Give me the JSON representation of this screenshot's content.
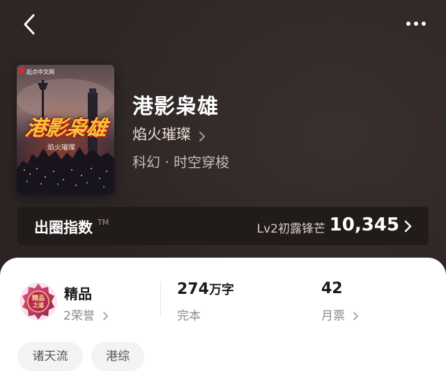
{
  "book": {
    "title": "港影枭雄",
    "author": "焰火璀璨",
    "tags_line": "科幻 · 时空穿梭"
  },
  "cover": {
    "publisher": "起点中文网",
    "title_art": "港影枭雄",
    "author_art": "焰火璀璨"
  },
  "index_bar": {
    "label": "出圈指数",
    "tm": "TM",
    "level": "Lv2初露锋芒",
    "value": "10,345"
  },
  "stats": {
    "honor_title": "精品",
    "honor_sub": "2荣誉",
    "words_number": "274",
    "words_unit": "万字",
    "words_sub": "完本",
    "tickets_number": "42",
    "tickets_sub": "月票"
  },
  "chips": [
    "诸天流",
    "港综"
  ],
  "colors": {
    "background": "#2d2524",
    "index_bar": "#211b1a",
    "sheet": "#ffffff",
    "chip_bg": "#f3f3f3"
  },
  "icons": {
    "back": "chevron-left-icon",
    "more": "more-dots-icon",
    "badge": "quality-badge-icon"
  }
}
